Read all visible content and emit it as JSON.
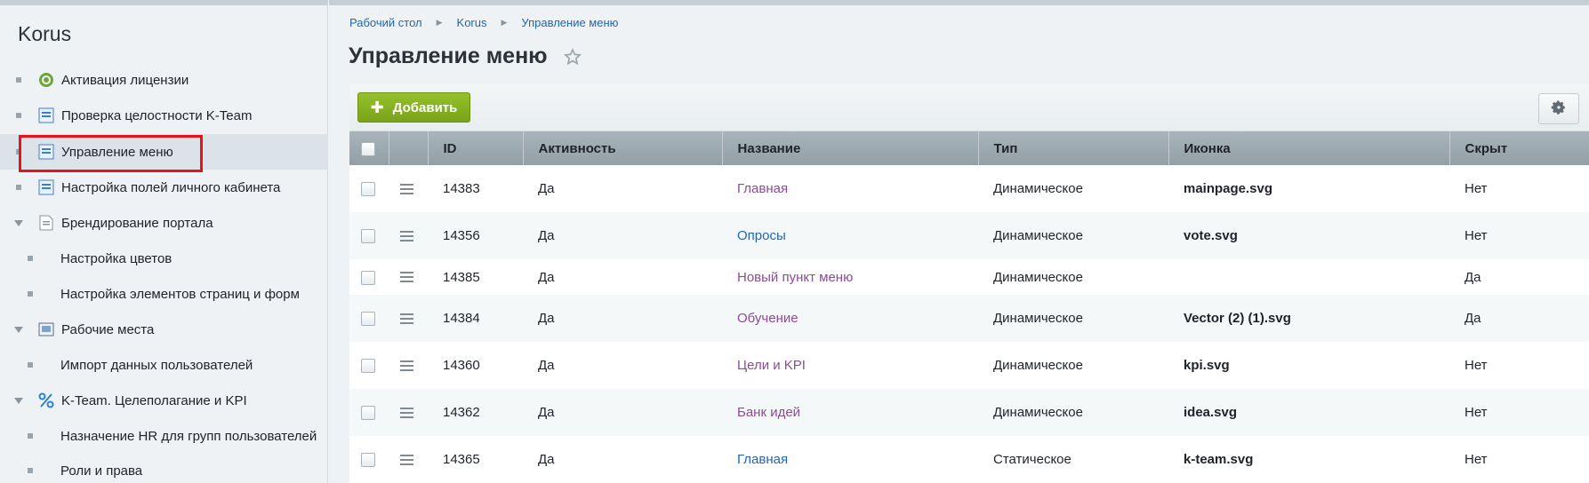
{
  "sidebar": {
    "title": "Korus",
    "items": [
      {
        "label": "Активация лицензии"
      },
      {
        "label": "Проверка целостности K-Team"
      },
      {
        "label": "Управление меню"
      },
      {
        "label": "Настройка полей личного кабинета"
      },
      {
        "label": "Брендирование портала"
      },
      {
        "label": "Настройка цветов"
      },
      {
        "label": "Настройка элементов страниц и форм"
      },
      {
        "label": "Рабочие места"
      },
      {
        "label": "Импорт данных пользователей"
      },
      {
        "label": "K-Team. Целеполагание и KPI"
      },
      {
        "label": "Назначение HR для групп пользователей"
      },
      {
        "label": "Роли и права"
      }
    ]
  },
  "breadcrumb": [
    "Рабочий стол",
    "Korus",
    "Управление меню"
  ],
  "page": {
    "title": "Управление меню"
  },
  "toolbar": {
    "add_label": "Добавить"
  },
  "table": {
    "columns": [
      "ID",
      "Активность",
      "Название",
      "Тип",
      "Иконка",
      "Скрыт"
    ],
    "rows": [
      {
        "id": "14383",
        "active": "Да",
        "name": "Главная",
        "type": "Динамическое",
        "icon": "mainpage.svg",
        "hidden": "Нет"
      },
      {
        "id": "14356",
        "active": "Да",
        "name": "Опросы",
        "type": "Динамическое",
        "icon": "vote.svg",
        "hidden": "Нет"
      },
      {
        "id": "14385",
        "active": "Да",
        "name": "Новый пункт меню",
        "type": "Динамическое",
        "icon": "",
        "hidden": "Да"
      },
      {
        "id": "14384",
        "active": "Да",
        "name": "Обучение",
        "type": "Динамическое",
        "icon": "Vector (2) (1).svg",
        "hidden": "Да"
      },
      {
        "id": "14360",
        "active": "Да",
        "name": "Цели и KPI",
        "type": "Динамическое",
        "icon": "kpi.svg",
        "hidden": "Нет"
      },
      {
        "id": "14362",
        "active": "Да",
        "name": "Банк идей",
        "type": "Динамическое",
        "icon": "idea.svg",
        "hidden": "Нет"
      },
      {
        "id": "14365",
        "active": "Да",
        "name": "Главная",
        "type": "Статическое",
        "icon": "k-team.svg",
        "hidden": "Нет"
      }
    ]
  }
}
